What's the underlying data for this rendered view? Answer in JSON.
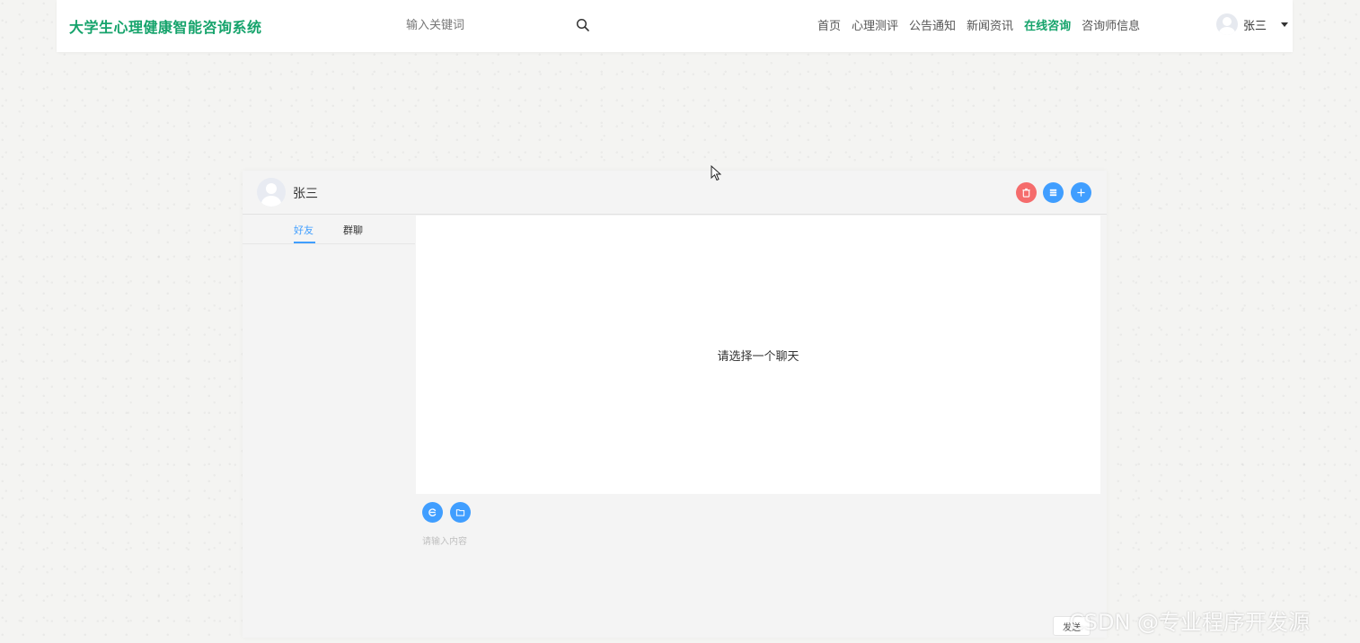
{
  "header": {
    "logo": "大学生心理健康智能咨询系统",
    "search": {
      "placeholder": "输入关键词",
      "value": ""
    },
    "nav": [
      {
        "label": "首页",
        "active": false
      },
      {
        "label": "心理测评",
        "active": false
      },
      {
        "label": "公告通知",
        "active": false
      },
      {
        "label": "新闻资讯",
        "active": false
      },
      {
        "label": "在线咨询",
        "active": true
      },
      {
        "label": "咨询师信息",
        "active": false
      }
    ],
    "user": {
      "name": "张三"
    }
  },
  "chat": {
    "current_user": "张三",
    "header_buttons": [
      {
        "icon": "trash-icon",
        "color": "#f56c6c"
      },
      {
        "icon": "list-icon",
        "color": "#409eff"
      },
      {
        "icon": "plus-icon",
        "color": "#409eff"
      }
    ],
    "tabs": [
      {
        "label": "好友",
        "active": true
      },
      {
        "label": "群聊",
        "active": false
      }
    ],
    "empty_tip": "请选择一个聊天",
    "toolbar": [
      {
        "icon": "emoji-icon"
      },
      {
        "icon": "folder-icon"
      }
    ],
    "input": {
      "placeholder": "请输入内容",
      "value": ""
    },
    "send_label": "发送"
  },
  "watermark": "CSDN @专业程序开发源",
  "colors": {
    "brand_green": "#15a36b",
    "accent_blue": "#409eff",
    "danger_red": "#f56c6c"
  }
}
